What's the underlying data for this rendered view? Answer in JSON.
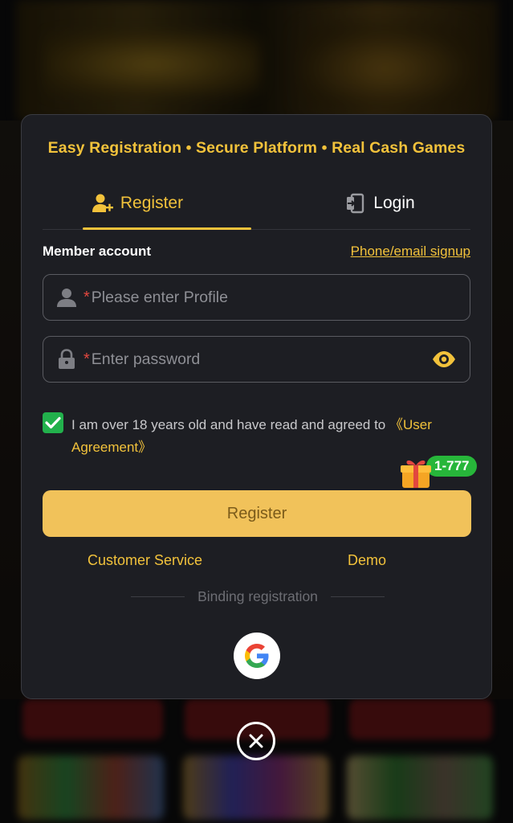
{
  "modal": {
    "tagline": "Easy Registration • Secure Platform • Real Cash Games",
    "tabs": {
      "register": "Register",
      "login": "Login"
    },
    "member_account_label": "Member account",
    "alt_signup_link": "Phone/email signup",
    "fields": {
      "profile": {
        "required_mark": "*",
        "placeholder": "Please enter Profile"
      },
      "password": {
        "required_mark": "*",
        "placeholder": "Enter password"
      }
    },
    "agreement": {
      "text": "I am over 18 years old and have read and agreed to ",
      "link": "《User Agreement》",
      "checked": true
    },
    "promo_badge": "1-777",
    "register_button": "Register",
    "customer_service": "Customer Service",
    "demo": "Demo",
    "binding_label": "Binding registration"
  },
  "icons": {
    "register_tab": "add-user-icon",
    "login_tab": "login-door-icon",
    "profile_field": "user-icon",
    "password_field": "lock-icon",
    "password_toggle": "eye-icon",
    "checkbox": "check-icon",
    "promo": "gift-icon",
    "social": "google-icon",
    "close": "close-icon"
  },
  "colors": {
    "accent": "#f2c23b",
    "button_fill": "#f1c25a",
    "modal_bg": "#1d1e23",
    "check_green": "#22b14c",
    "required_red": "#e2473f"
  }
}
